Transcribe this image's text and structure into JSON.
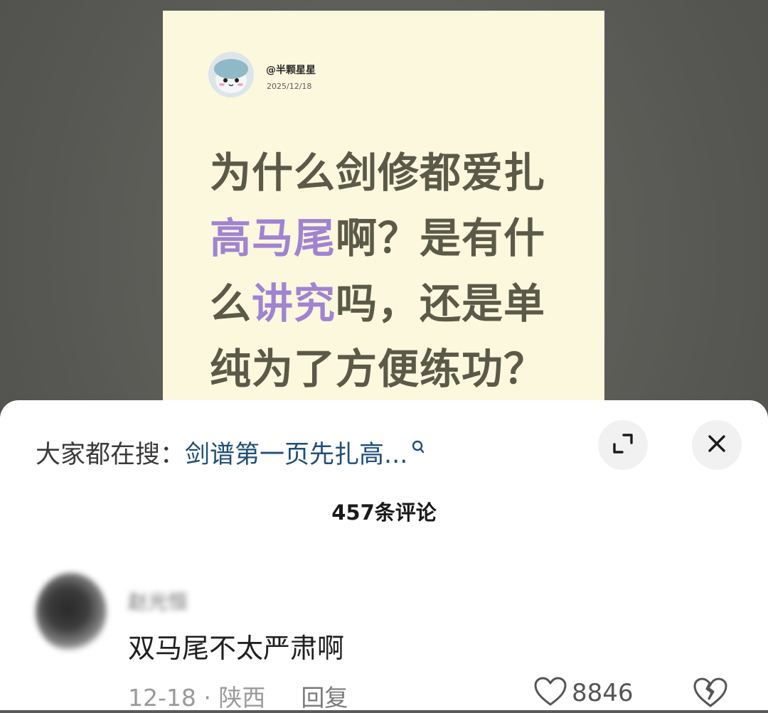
{
  "post": {
    "author": "@半颗星星",
    "date": "2025/12/18",
    "headline_parts": [
      {
        "text": "为什么剑修都爱扎",
        "highlight": false
      },
      {
        "text": "高马尾",
        "highlight": true
      },
      {
        "text": "啊？是有什么",
        "highlight": false
      },
      {
        "text": "讲究",
        "highlight": true
      },
      {
        "text": "吗，还是单纯为了方便练功？",
        "highlight": false
      }
    ]
  },
  "search": {
    "prefix": "大家都在搜：",
    "query": "剑谱第一页先扎高...",
    "icon": "search-icon"
  },
  "comments": {
    "count_label": "457条评论",
    "items": [
      {
        "name": "赵光恒",
        "text": "双马尾不太严肃啊",
        "date": "12-18",
        "location": "陕西",
        "reply_label": "回复",
        "likes": "8846"
      }
    ]
  },
  "colors": {
    "card_bg": "#fbf8de",
    "headline": "#5b5a48",
    "highlight": "#a183d1",
    "search_query": "#1e4e79"
  }
}
